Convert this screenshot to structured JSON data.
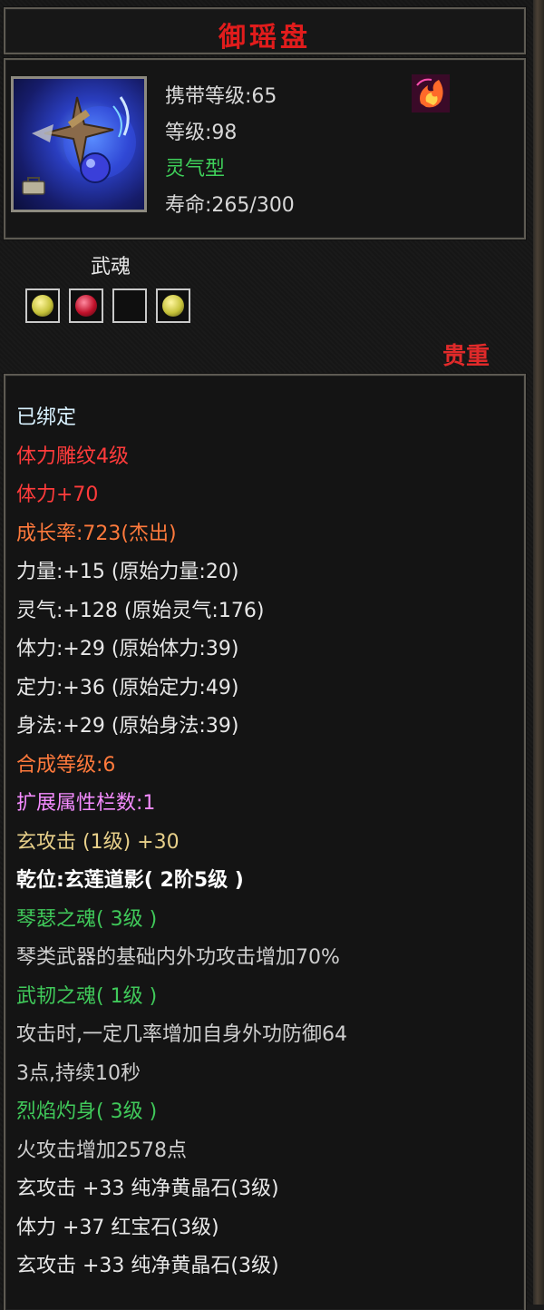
{
  "item": {
    "name": "御瑶盘",
    "carry_level": "携带等级:65",
    "level": "等级:98",
    "type": "灵气型",
    "lifespan": "寿命:265/300",
    "soul_label": "武魂",
    "rarity": "贵重"
  },
  "gems": [
    {
      "slot": "gem-slot-1",
      "color": "#c6c23a"
    },
    {
      "slot": "gem-slot-2",
      "color": "#c0112a"
    },
    {
      "slot": "gem-slot-3",
      "color": ""
    },
    {
      "slot": "gem-slot-4",
      "color": "#c6c23a"
    }
  ],
  "lines": [
    {
      "text": "已绑定",
      "style": "cyan"
    },
    {
      "text": "体力雕纹4级",
      "style": "red"
    },
    {
      "text": "体力+70",
      "style": "red"
    },
    {
      "text": "成长率:723(杰出)",
      "style": "orange"
    },
    {
      "text": "力量:+15  (原始力量:20)",
      "style": "white"
    },
    {
      "text": "灵气:+128  (原始灵气:176)",
      "style": "white"
    },
    {
      "text": "体力:+29  (原始体力:39)",
      "style": "white"
    },
    {
      "text": "定力:+36  (原始定力:49)",
      "style": "white"
    },
    {
      "text": "身法:+29  (原始身法:39)",
      "style": "white"
    },
    {
      "text": "合成等级:6",
      "style": "orange"
    },
    {
      "text": "扩展属性栏数:1",
      "style": "purple"
    },
    {
      "text": "玄攻击 (1级) +30",
      "style": "yellow"
    },
    {
      "text": "乾位:玄莲道影( 2阶5级 )",
      "style": "bright"
    },
    {
      "text": "琴瑟之魂( 3级 )",
      "style": "green"
    },
    {
      "text": "琴类武器的基础内外功攻击增加70%",
      "style": "grey"
    },
    {
      "text": "武韧之魂( 1级 )",
      "style": "green"
    },
    {
      "text": "攻击时,一定几率增加自身外功防御64",
      "style": "grey"
    },
    {
      "text": "3点,持续10秒",
      "style": "grey"
    },
    {
      "text": "烈焰灼身( 3级 )",
      "style": "green"
    },
    {
      "text": "火攻击增加2578点",
      "style": "grey"
    },
    {
      "text": "玄攻击  +33  纯净黄晶石(3级)",
      "style": "white"
    },
    {
      "text": "体力  +37  红宝石(3级)",
      "style": "white"
    },
    {
      "text": "玄攻击  +33  纯净黄晶石(3级)",
      "style": "white"
    }
  ]
}
